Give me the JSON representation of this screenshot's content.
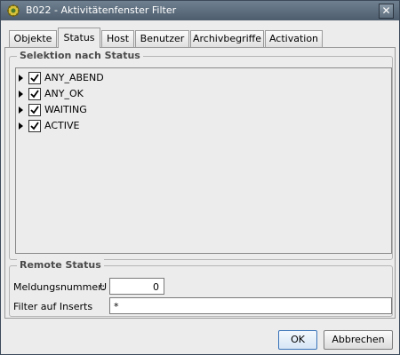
{
  "window": {
    "title": "B022 - Aktivitätenfenster Filter",
    "close_glyph": "✕"
  },
  "tabs": [
    {
      "label": "Objekte",
      "active": false
    },
    {
      "label": "Status",
      "active": true
    },
    {
      "label": "Host",
      "active": false
    },
    {
      "label": "Benutzer",
      "active": false
    },
    {
      "label": "Archivbegriffe",
      "active": false
    },
    {
      "label": "Activation",
      "active": false
    }
  ],
  "selection": {
    "legend": "Selektion nach Status",
    "items": [
      {
        "label": "ANY_ABEND",
        "checked": true
      },
      {
        "label": "ANY_OK",
        "checked": true
      },
      {
        "label": "WAITING",
        "checked": true
      },
      {
        "label": "ACTIVE",
        "checked": true
      }
    ]
  },
  "remote": {
    "legend": "Remote Status",
    "msgnum_label": "Meldungsnummer:",
    "msgnum_op": "U",
    "msgnum_value": "0",
    "filter_label": "Filter auf Inserts",
    "filter_value": "*"
  },
  "buttons": {
    "ok": "OK",
    "cancel": "Abbrechen"
  }
}
